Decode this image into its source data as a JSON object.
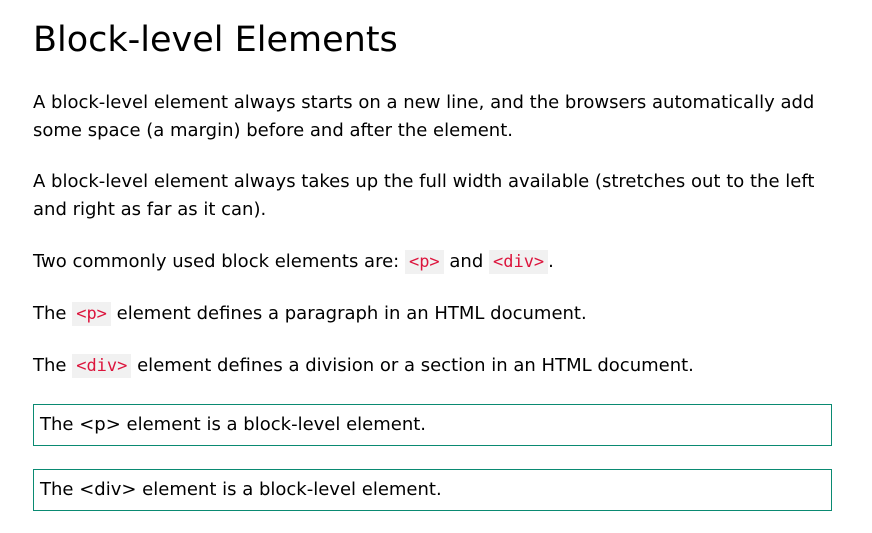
{
  "title": "Block-level Elements",
  "paragraphs": {
    "p1": "A block-level element always starts on a new line, and the browsers automatically add some space (a margin) before and after the element.",
    "p2": "A block-level element always takes up the full width available (stretches out to the left and right as far as it can).",
    "p3": {
      "prefix": "Two commonly used block elements are: ",
      "code1": "<p>",
      "middle": " and ",
      "code2": "<div>",
      "suffix": "."
    },
    "p4": {
      "prefix": "The ",
      "code": "<p>",
      "suffix": " element defines a paragraph in an HTML document."
    },
    "p5": {
      "prefix": "The ",
      "code": "<div>",
      "suffix": " element defines a division or a section in an HTML document."
    }
  },
  "examples": {
    "p_box": "The <p> element is a block-level element.",
    "div_box": "The <div> element is a block-level element."
  },
  "colors": {
    "code_text": "#dc143c",
    "code_bg": "#f1f1f1",
    "box_border": "#0a8a72"
  }
}
